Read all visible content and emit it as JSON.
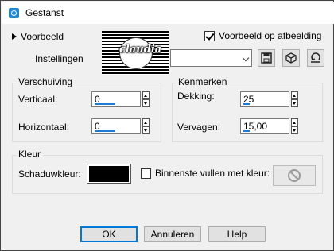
{
  "window": {
    "title": "Gestanst"
  },
  "preview": {
    "toggle_label": "Voorbeeld",
    "checkbox_label": "Voorbeeld op afbeelding",
    "checkbox_checked": true,
    "thumbnail_signature": "claudia"
  },
  "settings": {
    "label": "Instellingen",
    "combo_value": "",
    "icons": [
      "save-icon",
      "presets-icon",
      "reset-icon"
    ]
  },
  "offset_group": {
    "title": "Verschuiving",
    "vertical_label": "Verticaal:",
    "vertical_value": "0",
    "horizontal_label": "Horizontaal:",
    "horizontal_value": "0"
  },
  "properties_group": {
    "title": "Kenmerken",
    "opacity_label": "Dekking:",
    "opacity_value": "25",
    "blur_label": "Vervagen:",
    "blur_value": "15,00"
  },
  "color_group": {
    "title": "Kleur",
    "shadow_color_label": "Schaduwkleur:",
    "shadow_color": "#000000",
    "fill_label": "Binnenste vullen met kleur:",
    "fill_checked": false
  },
  "buttons": {
    "ok": "OK",
    "cancel": "Annuleren",
    "help": "Help"
  },
  "colors": {
    "accent": "#0078d7",
    "background": "#f0f0f0"
  }
}
